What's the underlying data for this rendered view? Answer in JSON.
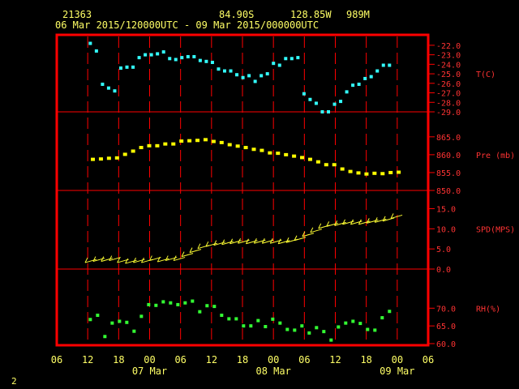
{
  "header": {
    "station_id": "21363",
    "latitude": "84.90S",
    "longitude": "128.85W",
    "elevation": "989M",
    "time_range": "06 Mar 2015/120000UTC - 09 Mar 2015/000000UTC"
  },
  "corner_label": "2",
  "colors": {
    "frame": "#ff0000",
    "text": "#ffff66",
    "axis_text": "#ff3333",
    "temperature": "#33ffff",
    "pressure": "#ffff00",
    "wind": "#ffff33",
    "humidity": "#33ff33"
  },
  "chart_data": [
    {
      "type": "scatter",
      "panel": "temperature",
      "ylabel": "T(C)",
      "ylim": [
        -29.0,
        -21.5
      ],
      "yticks": [
        "-22.0",
        "-23.0",
        "-24.0",
        "-25.0",
        "-26.0",
        "-27.0",
        "-28.0",
        "-29.0"
      ],
      "ytick_values": [
        -22,
        -23,
        -24,
        -25,
        -26,
        -27,
        -28,
        -29
      ],
      "x_hours": [
        1,
        2,
        3,
        4,
        5,
        6,
        7,
        8,
        9,
        10,
        11,
        12,
        13,
        14,
        15,
        16,
        17,
        18,
        19,
        20,
        21,
        22,
        23,
        24,
        25,
        26,
        27,
        28,
        29,
        30,
        31,
        32,
        33,
        34,
        35,
        36,
        37,
        38,
        39,
        40,
        41,
        42,
        43,
        44,
        45,
        46,
        47,
        48,
        49,
        50,
        51,
        52,
        53,
        54,
        55,
        56,
        57,
        58
      ],
      "values": [
        -21.8,
        -22.6,
        -26.1,
        -26.5,
        -26.8,
        -24.4,
        -24.3,
        -24.3,
        -23.3,
        -23.0,
        -23.0,
        -22.9,
        -22.7,
        -23.4,
        -23.5,
        -23.3,
        -23.2,
        -23.2,
        -23.6,
        -23.7,
        -23.8,
        -24.5,
        -24.7,
        -24.7,
        -25.1,
        -25.4,
        -25.2,
        -25.8,
        -25.2,
        -25.0,
        -23.9,
        -24.1,
        -23.4,
        -23.4,
        -23.3,
        -27.1,
        -27.7,
        -28.1,
        -29.0,
        -29.0,
        -28.2,
        -27.9,
        -26.9,
        -26.2,
        -26.1,
        -25.5,
        -25.3,
        -24.7,
        -24.1,
        -24.1
      ],
      "x": [
        1,
        2,
        3,
        4,
        5,
        6,
        7,
        8,
        9,
        10,
        11,
        12,
        13,
        14,
        15,
        16,
        17,
        18,
        19,
        20,
        21,
        22,
        23,
        24,
        25,
        26,
        27,
        28,
        29,
        30,
        31,
        32,
        33,
        34,
        35,
        36,
        37,
        38,
        39,
        40,
        41,
        42,
        43,
        44,
        45,
        46,
        47,
        48,
        49,
        50
      ]
    },
    {
      "type": "scatter",
      "panel": "pressure",
      "ylabel": "Pre (mb)",
      "ylim": [
        850,
        867
      ],
      "yticks": [
        "865.0",
        "860.0",
        "855.0",
        "850.0"
      ],
      "ytick_values": [
        865,
        860,
        855,
        850
      ],
      "x": [
        0,
        2,
        4,
        6,
        8,
        10,
        12,
        14,
        16,
        18,
        20,
        22,
        24,
        26,
        28,
        30,
        32,
        34,
        36,
        38,
        40,
        42,
        44,
        46,
        48,
        50,
        52,
        54,
        56,
        58,
        60,
        62,
        64,
        66,
        68,
        70,
        72,
        74,
        76
      ],
      "values": [
        858.7,
        858.8,
        859.0,
        859.1,
        860.1,
        861.0,
        862.0,
        862.5,
        862.5,
        863.0,
        863.0,
        863.8,
        863.9,
        864.0,
        864.2,
        863.7,
        863.4,
        862.8,
        862.4,
        862.0,
        861.5,
        861.2,
        860.5,
        860.4,
        860.0,
        859.6,
        859.2,
        858.7,
        858.0,
        857.2,
        857.2,
        856.0,
        855.3,
        854.9,
        854.6,
        854.8,
        854.7,
        855.0,
        855.1
      ]
    },
    {
      "type": "line",
      "panel": "wind",
      "ylabel": "SPD(MPS)",
      "ylim": [
        0,
        15.5
      ],
      "yticks": [
        "15.0",
        "10.0",
        "5.0",
        "0.0"
      ],
      "ytick_values": [
        15,
        10,
        5,
        0
      ],
      "x": [
        0,
        2,
        4,
        6,
        8,
        10,
        12,
        14,
        16,
        18,
        20,
        22,
        24,
        26,
        28,
        30,
        32,
        34,
        36,
        38,
        40,
        42,
        44,
        46,
        48,
        50,
        52,
        54,
        56,
        58,
        60,
        62,
        64,
        66,
        68,
        70,
        72,
        74,
        76
      ],
      "values": [
        2.0,
        2.3,
        2.3,
        2.5,
        2.0,
        1.8,
        2.0,
        2.0,
        2.5,
        2.2,
        2.5,
        2.5,
        3.5,
        4.5,
        5.5,
        6.0,
        6.3,
        6.5,
        6.7,
        6.8,
        6.7,
        6.8,
        6.8,
        6.8,
        6.7,
        7.0,
        7.5,
        8.5,
        9.5,
        10.5,
        11.0,
        11.2,
        11.5,
        11.5,
        11.5,
        11.8,
        12.0,
        12.3,
        13.0
      ]
    },
    {
      "type": "scatter",
      "panel": "humidity",
      "ylabel": "RH(%)",
      "ylim": [
        60,
        73.5
      ],
      "yticks": [
        "70.0",
        "65.0",
        "60.0"
      ],
      "ytick_values": [
        70,
        65,
        60
      ],
      "x": [
        0,
        1,
        2,
        3,
        4,
        5,
        6,
        7,
        8,
        9,
        10,
        11,
        12,
        13,
        14,
        15,
        16,
        17,
        18,
        19,
        20,
        21,
        22,
        23,
        24,
        25,
        26,
        27,
        28,
        29,
        30,
        31,
        32,
        33,
        34,
        35,
        36,
        37,
        38,
        39,
        40,
        41,
        42,
        43,
        44,
        45,
        46,
        47,
        48,
        49
      ],
      "values": [
        66.8,
        68.0,
        62.0,
        65.8,
        66.3,
        66.0,
        63.5,
        67.7,
        71.0,
        70.8,
        71.8,
        71.5,
        71.0,
        71.5,
        72.0,
        69.0,
        70.7,
        70.5,
        68.0,
        67.0,
        67.0,
        65.0,
        65.0,
        66.5,
        64.8,
        66.9,
        65.8,
        64.0,
        63.8,
        65.0,
        63.0,
        64.5,
        63.4,
        61.0,
        64.7,
        65.8,
        66.3,
        65.7,
        64.0,
        63.8,
        67.3,
        69.1
      ]
    },
    {
      "type": "axis",
      "panel": "time-axis",
      "xlim_hours": [
        -6,
        66
      ],
      "xticks_hours": [
        -6,
        0,
        6,
        12,
        18,
        24,
        30,
        36,
        42,
        48,
        54,
        60,
        66
      ],
      "xtick_labels": [
        "06",
        "12",
        "18",
        "00",
        "06",
        "12",
        "18",
        "00",
        "06",
        "12",
        "18",
        "00",
        "06"
      ],
      "date_labels": [
        "07 Mar",
        "08 Mar",
        "09 Mar"
      ],
      "date_label_hours": [
        12,
        36,
        60
      ]
    }
  ]
}
